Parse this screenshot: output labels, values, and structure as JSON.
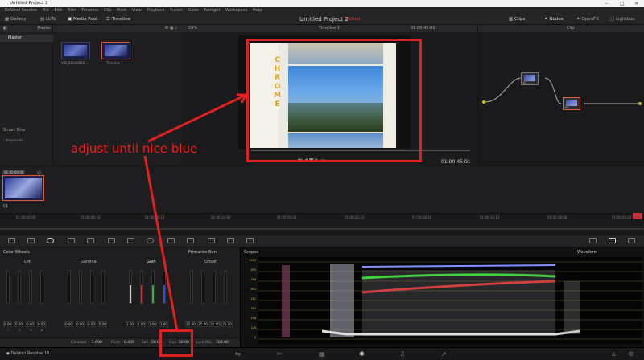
{
  "window": {
    "title": "Untitled Project 2",
    "min": "–",
    "max": "□",
    "close": "×"
  },
  "menu": [
    "DaVinci Resolve",
    "File",
    "Edit",
    "Trim",
    "Timeline",
    "Clip",
    "Mark",
    "View",
    "Playback",
    "Fusion",
    "Color",
    "Fairlight",
    "Workspace",
    "Help"
  ],
  "toolbar": {
    "gallery": "Gallery",
    "luts": "LUTs",
    "media_pool": "Media Pool",
    "timeline": "Timeline",
    "project_title": "Untitled Project 2",
    "edited": "Edited",
    "clips": "Clips",
    "nodes": "Nodes",
    "openfx": "OpenFX",
    "lightbox": "Lightbox"
  },
  "media": {
    "master_header": "Master",
    "master_item": "Master",
    "smart_bins": "Smart Bins",
    "keywords": "Keywords",
    "clips": [
      {
        "label": "VID_20240610..."
      },
      {
        "label": "Timeline 1"
      }
    ]
  },
  "viewer": {
    "zoom": "29%",
    "timeline_name": "Timeline 1",
    "timecode": "01:00:45:01",
    "top_timecode": "01:00:45:01",
    "chrome_letters": "CHROME"
  },
  "node_editor": {
    "title": "Clip",
    "node1": "01",
    "node2": "02"
  },
  "timeline_strip": {
    "clip_tc": "01:00:00:00",
    "track": "V1",
    "clip_name": "C1"
  },
  "ruler_ticks": [
    "01:00:00:00",
    "01:00:04:18",
    "01:00:09:13",
    "01:00:14:08",
    "01:00:19:03",
    "01:00:23:23",
    "01:00:28:18",
    "01:00:33:13",
    "01:00:38:08",
    "01:00:43:03"
  ],
  "color_wheels": {
    "panel_title": "Color Wheels",
    "mode": "Primaries Bars",
    "groups": [
      {
        "name": "Lift",
        "values": [
          "0.00",
          "0.00",
          "0.00",
          "0.00"
        ]
      },
      {
        "name": "Gamma",
        "values": [
          "0.00",
          "0.00",
          "0.00",
          "0.00"
        ]
      },
      {
        "name": "Gain",
        "values": [
          "1.00",
          "1.00",
          "1.00",
          "1.00"
        ]
      },
      {
        "name": "Offset",
        "values": [
          "25.00",
          "25.00",
          "25.00",
          "25.00"
        ]
      }
    ],
    "channels": [
      "Y",
      "R",
      "G",
      "B"
    ]
  },
  "params": {
    "contrast_label": "Contrast",
    "contrast": "1.000",
    "pivot_label": "Pivot",
    "pivot": "0.435",
    "sat_label": "Sat",
    "sat": "50.00",
    "hue_label": "Hue",
    "hue": "50.00",
    "lum_label": "Lum Mix",
    "lum": "100.00"
  },
  "scopes": {
    "title": "Scopes",
    "type": "Waveform",
    "scale": [
      "1023",
      "896",
      "768",
      "640",
      "512",
      "384",
      "256",
      "128",
      "0"
    ]
  },
  "bottom": {
    "app": "DaVinci Resolve 16"
  },
  "annotation": {
    "text": "adjust until nice blue"
  },
  "colors": {
    "accent": "#e0573a",
    "annotation": "#e02020",
    "lift": "#9a9a9a",
    "gain_y": "#cfcfcf",
    "red": "#d03030",
    "green": "#30b040",
    "blue": "#3050d0"
  }
}
